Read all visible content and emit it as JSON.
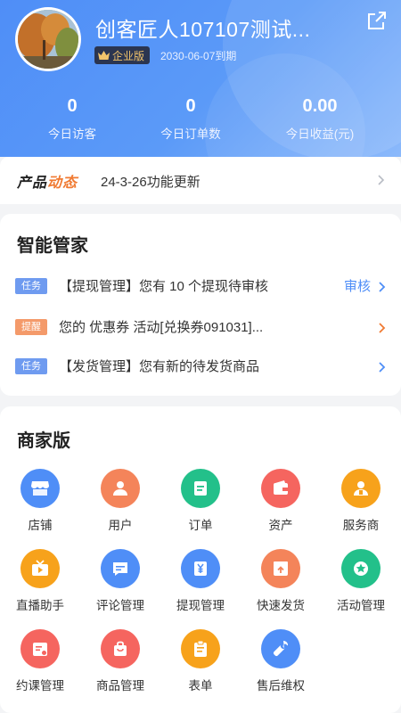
{
  "header": {
    "store_name": "创客匠人107107测试...",
    "badge_label": "企业版",
    "expire_text": "2030-06-07到期",
    "stats": [
      {
        "value": "0",
        "label": "今日访客"
      },
      {
        "value": "0",
        "label": "今日订单数"
      },
      {
        "value": "0.00",
        "label": "今日收益(元)"
      }
    ]
  },
  "news": {
    "logo_part1": "产品",
    "logo_part2": "动态",
    "text": "24-3-26功能更新"
  },
  "assistant": {
    "title": "智能管家",
    "items": [
      {
        "tag": "任务",
        "tag_color": "#6f9bf0",
        "text": "【提现管理】您有 10 个提现待审核",
        "action": "审核"
      },
      {
        "tag": "提醒",
        "tag_color": "#f49a6a",
        "text": "您的 优惠券 活动[兑换券091031]...",
        "action": ""
      },
      {
        "tag": "任务",
        "tag_color": "#6f9bf0",
        "text": "【发货管理】您有新的待发货商品",
        "action": ""
      }
    ]
  },
  "merchant": {
    "title": "商家版",
    "items": [
      {
        "label": "店铺",
        "icon": "store-icon",
        "color": "#4f8ef7"
      },
      {
        "label": "用户",
        "icon": "user-icon",
        "color": "#f4845a"
      },
      {
        "label": "订单",
        "icon": "order-icon",
        "color": "#23c08a"
      },
      {
        "label": "资产",
        "icon": "wallet-icon",
        "color": "#f5655f"
      },
      {
        "label": "服务商",
        "icon": "service-provider-icon",
        "color": "#f7a21b"
      },
      {
        "label": "直播助手",
        "icon": "live-tv-icon",
        "color": "#f7a21b"
      },
      {
        "label": "评论管理",
        "icon": "comment-icon",
        "color": "#4f8ef7"
      },
      {
        "label": "提现管理",
        "icon": "withdraw-icon",
        "color": "#4f8ef7"
      },
      {
        "label": "快速发货",
        "icon": "ship-box-icon",
        "color": "#f4845a"
      },
      {
        "label": "活动管理",
        "icon": "activity-star-icon",
        "color": "#23c08a"
      },
      {
        "label": "约课管理",
        "icon": "calendar-icon",
        "color": "#f5655f"
      },
      {
        "label": "商品管理",
        "icon": "shopping-bag-icon",
        "color": "#f5655f"
      },
      {
        "label": "表单",
        "icon": "form-icon",
        "color": "#f7a21b"
      },
      {
        "label": "售后维权",
        "icon": "wrench-icon",
        "color": "#4f8ef7"
      }
    ]
  }
}
